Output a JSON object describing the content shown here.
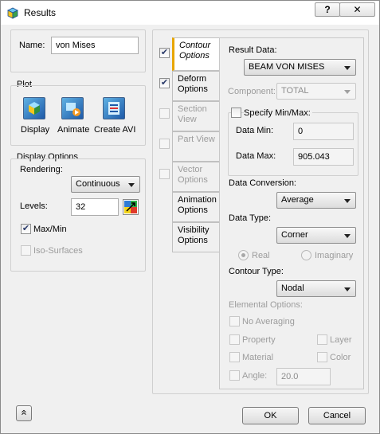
{
  "window": {
    "title": "Results",
    "help_label": "?",
    "close_label": "✕"
  },
  "name": {
    "label": "Name:",
    "value": "von Mises"
  },
  "plot": {
    "title": "Plot",
    "display_label": "Display",
    "animate_label": "Animate",
    "create_avi_label": "Create AVI"
  },
  "display_options": {
    "title": "Display Options",
    "rendering_label": "Rendering:",
    "rendering_value": "Continuous",
    "levels_label": "Levels:",
    "levels_value": "32",
    "maxmin_label": "Max/Min",
    "maxmin_checked": true,
    "iso_label": "Iso-Surfaces",
    "iso_checked": false
  },
  "tabs": [
    {
      "label": "Contour Options",
      "checked": true,
      "enabled": true
    },
    {
      "label": "Deform Options",
      "checked": true,
      "enabled": true
    },
    {
      "label": "Section View",
      "checked": false,
      "enabled": false
    },
    {
      "label": "Part View",
      "checked": false,
      "enabled": false
    },
    {
      "label": "Vector Options",
      "checked": false,
      "enabled": false
    },
    {
      "label": "Animation Options"
    },
    {
      "label": "Visibility Options"
    }
  ],
  "contour": {
    "result_data_label": "Result Data:",
    "result_data_value": "BEAM VON MISES",
    "component_label": "Component:",
    "component_value": "TOTAL",
    "specify_label": "Specify Min/Max:",
    "data_min_label": "Data Min:",
    "data_min_value": "0",
    "data_max_label": "Data Max:",
    "data_max_value": "905.043",
    "conversion_label": "Data Conversion:",
    "conversion_value": "Average",
    "data_type_label": "Data Type:",
    "data_type_value": "Corner",
    "real_label": "Real",
    "imaginary_label": "Imaginary",
    "contour_type_label": "Contour Type:",
    "contour_type_value": "Nodal",
    "elemental_label": "Elemental Options:",
    "no_averaging_label": "No Averaging",
    "property_label": "Property",
    "layer_label": "Layer",
    "material_label": "Material",
    "color_label": "Color",
    "angle_label": "Angle:",
    "angle_value": "20.0"
  },
  "footer": {
    "collapse_label": "»",
    "ok_label": "OK",
    "cancel_label": "Cancel"
  }
}
